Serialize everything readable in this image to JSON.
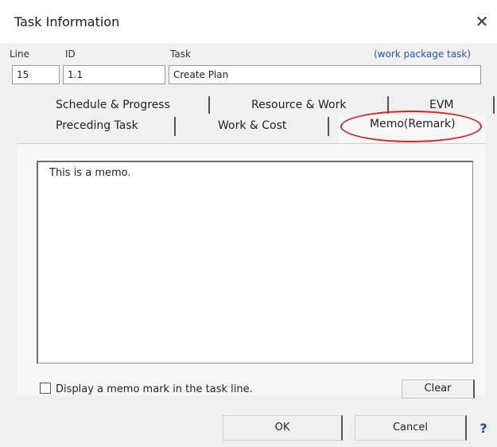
{
  "window": {
    "title": "Task Information",
    "close_glyph": "✕"
  },
  "fields": {
    "line_label": "Line",
    "id_label": "ID",
    "task_label": "Task",
    "line_value": "15",
    "id_value": "1.1",
    "task_value": "Create Plan",
    "work_package_note": "(work package task)"
  },
  "tabs": {
    "row1": [
      "Schedule & Progress",
      "Resource & Work",
      "EVM"
    ],
    "row2": [
      "Preceding Task",
      "Work & Cost",
      "Memo(Remark)"
    ],
    "active": "Memo(Remark)"
  },
  "memo": {
    "text": "This is a memo.",
    "checkbox_label": "Display a memo mark in the task line.",
    "checkbox_checked": false,
    "clear_label": "Clear"
  },
  "footer": {
    "ok_label": "OK",
    "cancel_label": "Cancel",
    "help_label": "?"
  },
  "colors": {
    "highlight_oval": "#d92424",
    "note_text": "#2a4fd0",
    "help_icon": "#1f46c9"
  }
}
